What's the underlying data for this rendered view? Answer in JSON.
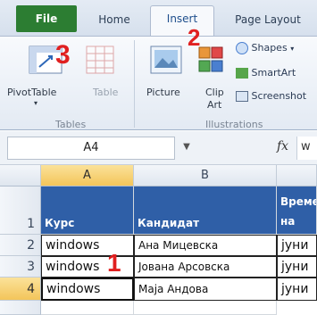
{
  "tabs": {
    "file": "File",
    "home": "Home",
    "insert": "Insert",
    "page_layout": "Page Layout"
  },
  "ribbon": {
    "pivot_table": "PivotTable",
    "table": "Table",
    "picture": "Picture",
    "clip_art_line1": "Clip",
    "clip_art_line2": "Art",
    "shapes": "Shapes",
    "smartart": "SmartArt",
    "screenshot": "Screenshot",
    "group_tables": "Tables",
    "group_illustrations": "Illustrations"
  },
  "annotations": {
    "one": "1",
    "two": "2",
    "three": "3",
    "color": "#e02020"
  },
  "formula_bar": {
    "name_box": "A4",
    "fx": "fx",
    "content": "w"
  },
  "grid": {
    "columns": [
      "A",
      "B"
    ],
    "rows": [
      "1",
      "2",
      "3",
      "4"
    ],
    "header_row": [
      "Курс",
      "Кандидат",
      "Време на полагање"
    ],
    "data": [
      [
        "windows",
        "Ана Мицевска",
        "јуни"
      ],
      [
        "windows",
        "Јована Арсовска",
        "јуни"
      ],
      [
        "windows",
        "Маја Андова",
        "јуни"
      ]
    ],
    "header_color": "#2f5fa7",
    "selected_header_color": "#f3c55a"
  }
}
